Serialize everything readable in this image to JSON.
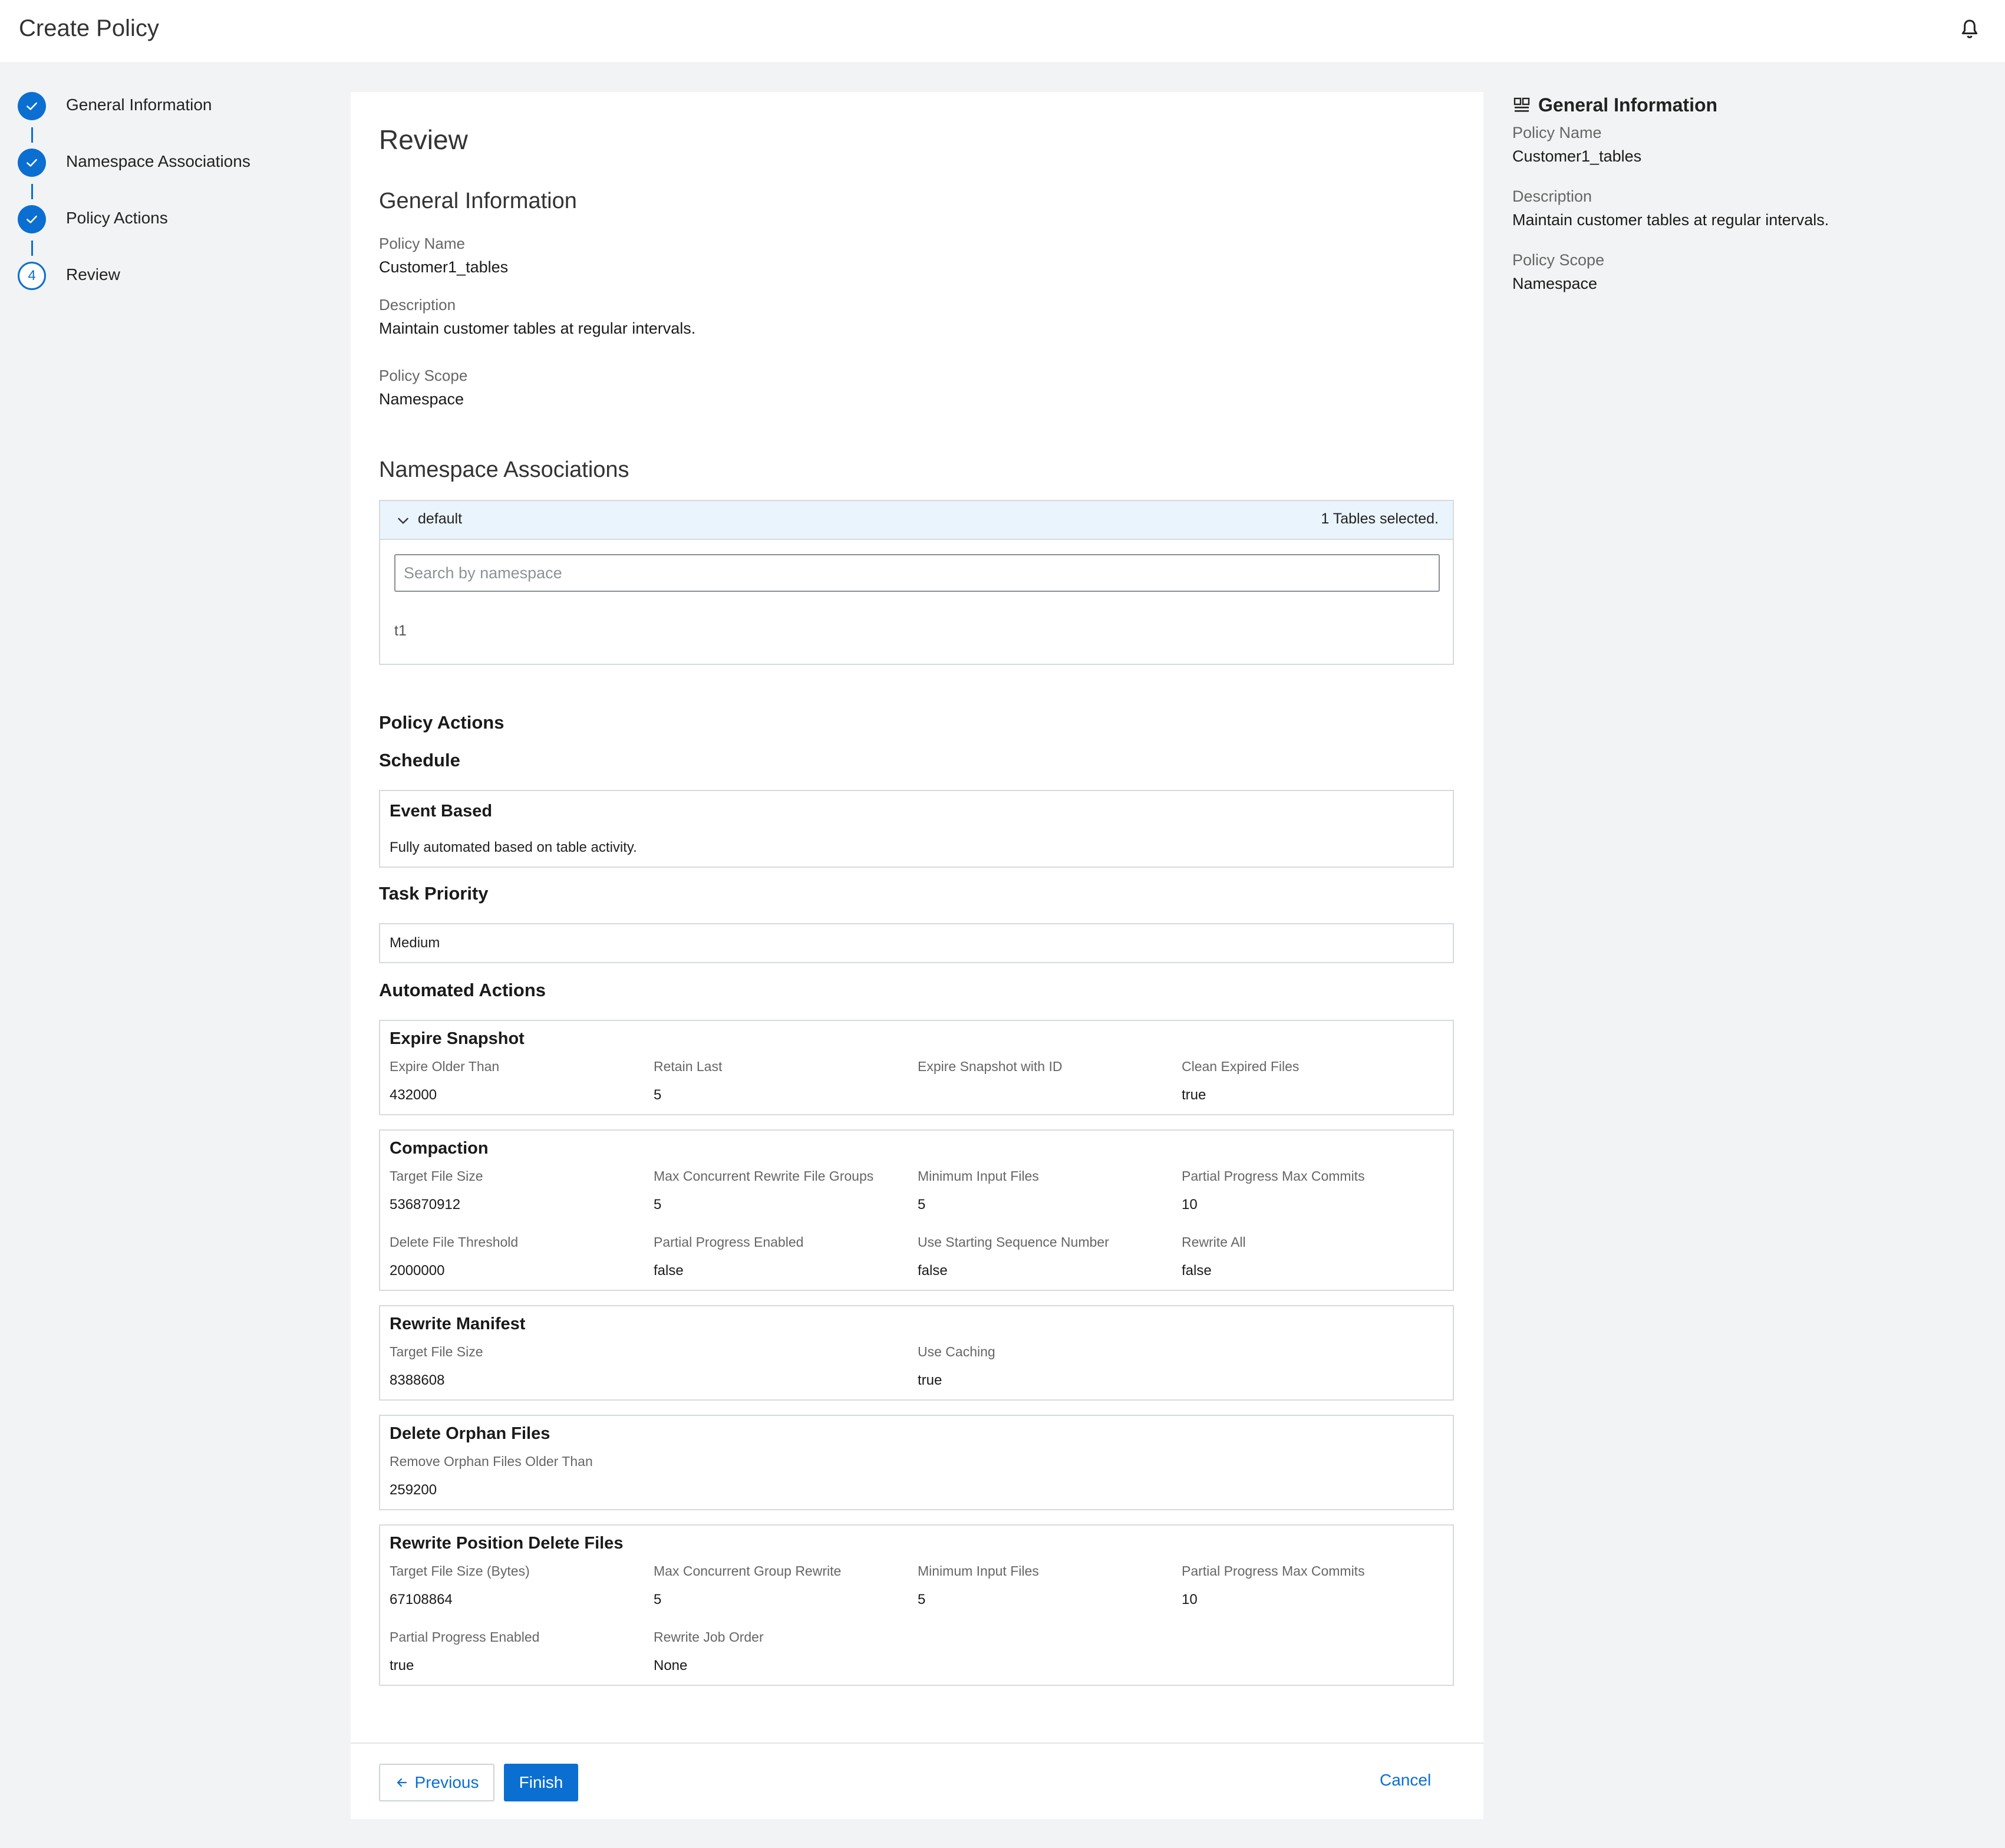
{
  "header": {
    "title": "Create Policy",
    "bell_icon": "bell-icon"
  },
  "stepper": {
    "steps": [
      {
        "number": "1",
        "label": "General Information",
        "state": "done"
      },
      {
        "number": "2",
        "label": "Namespace Associations",
        "state": "done"
      },
      {
        "number": "3",
        "label": "Policy Actions",
        "state": "done"
      },
      {
        "number": "4",
        "label": "Review",
        "state": "current"
      }
    ]
  },
  "review": {
    "title": "Review",
    "general": {
      "heading": "General Information",
      "policy_name_label": "Policy Name",
      "policy_name": "Customer1_tables",
      "description_label": "Description",
      "description": "Maintain customer tables at regular intervals.",
      "scope_label": "Policy Scope",
      "scope": "Namespace"
    },
    "namespace": {
      "heading": "Namespace Associations",
      "name": "default",
      "count": "1 Tables selected.",
      "search_placeholder": "Search by namespace",
      "tables": [
        "t1"
      ]
    },
    "actions": {
      "heading": "Policy Actions",
      "schedule_heading": "Schedule",
      "schedule_title": "Event Based",
      "schedule_desc": "Fully automated based on table activity.",
      "priority_heading": "Task Priority",
      "priority": "Medium",
      "automated_heading": "Automated Actions",
      "expire": {
        "title": "Expire Snapshot",
        "labels": [
          "Expire Older Than",
          "Retain Last",
          "Expire Snapshot with ID",
          "Clean Expired Files"
        ],
        "values": [
          "432000",
          "5",
          "",
          "true"
        ]
      },
      "compaction": {
        "title": "Compaction",
        "row1_labels": [
          "Target File Size",
          "Max Concurrent Rewrite File Groups",
          "Minimum Input Files",
          "Partial Progress Max Commits"
        ],
        "row1_values": [
          "536870912",
          "5",
          "5",
          "10"
        ],
        "row2_labels": [
          "Delete File Threshold",
          "Partial Progress Enabled",
          "Use Starting Sequence Number",
          "Rewrite All"
        ],
        "row2_values": [
          "2000000",
          "false",
          "false",
          "false"
        ]
      },
      "manifest": {
        "title": "Rewrite Manifest",
        "labels": [
          "Target File Size",
          "Use Caching"
        ],
        "values": [
          "8388608",
          "true"
        ]
      },
      "orphan": {
        "title": "Delete Orphan Files",
        "labels": [
          "Remove Orphan Files Older Than"
        ],
        "values": [
          "259200"
        ]
      },
      "position_delete": {
        "title": "Rewrite Position Delete Files",
        "row1_labels": [
          "Target File Size (Bytes)",
          "Max Concurrent Group Rewrite",
          "Minimum Input Files",
          "Partial Progress Max Commits"
        ],
        "row1_values": [
          "67108864",
          "5",
          "5",
          "10"
        ],
        "row2_labels": [
          "Partial Progress Enabled",
          "Rewrite Job Order"
        ],
        "row2_values": [
          "true",
          "None"
        ]
      }
    }
  },
  "footer": {
    "previous": "Previous",
    "finish": "Finish",
    "cancel": "Cancel"
  },
  "summary": {
    "heading": "General Information",
    "policy_name_label": "Policy Name",
    "policy_name": "Customer1_tables",
    "description_label": "Description",
    "description": "Maintain customer tables at regular intervals.",
    "scope_label": "Policy Scope",
    "scope": "Namespace"
  },
  "colors": {
    "accent": "#0a6fd1",
    "ns_header_bg": "#eaf4fc"
  }
}
